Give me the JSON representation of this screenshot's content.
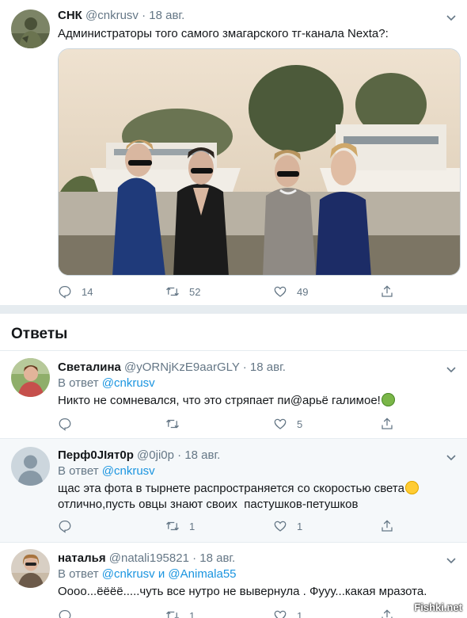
{
  "main_tweet": {
    "name": "СНК",
    "handle": "@cnkrusv",
    "dot": "·",
    "date": "18 авг.",
    "text": "Администраторы того самого змагарского тг-канала Nexta?:",
    "replies": "14",
    "retweets": "52",
    "likes": "49"
  },
  "answers_title": "Ответы",
  "replies": [
    {
      "name": "Светалина",
      "handle": "@yORNjKzE9aarGLY",
      "dot": "·",
      "date": "18 авг.",
      "reply_prefix": "В ответ",
      "reply_to": "@cnkrusv",
      "reply_to_2": "",
      "reply_and": "",
      "lines": [
        "Никто не сомневался, что это стряпает пи@арьё галимое!"
      ],
      "emoji": "nauseated-face",
      "replies": "",
      "retweets": "",
      "likes": "5"
    },
    {
      "name": "Перф0JIят0р",
      "handle": "@0ji0p",
      "dot": "·",
      "date": "18 авг.",
      "reply_prefix": "В ответ",
      "reply_to": "@cnkrusv",
      "lines": [
        "щас эта фота в тырнете распространяется со скоростью света",
        "отлично,пусть овцы знают своих  пастушков-петушков"
      ],
      "emoji": "grinning-face",
      "replies": "",
      "retweets": "1",
      "likes": "1"
    },
    {
      "name": "наталья",
      "handle": "@natali195821",
      "dot": "·",
      "date": "18 авг.",
      "reply_prefix": "В ответ",
      "reply_to": "@cnkrusv",
      "reply_and": "и",
      "reply_to_2": "@Animala55",
      "lines": [
        "Оооо...ёёёё.....чуть все нутро не вывернула . Фууу...какая мразота."
      ],
      "replies": "",
      "retweets": "1",
      "likes": "1"
    }
  ],
  "watermark": "Fishki.net",
  "colors": {
    "link": "#1b95e0",
    "muted": "#657786",
    "divider": "#e6ecf0"
  }
}
